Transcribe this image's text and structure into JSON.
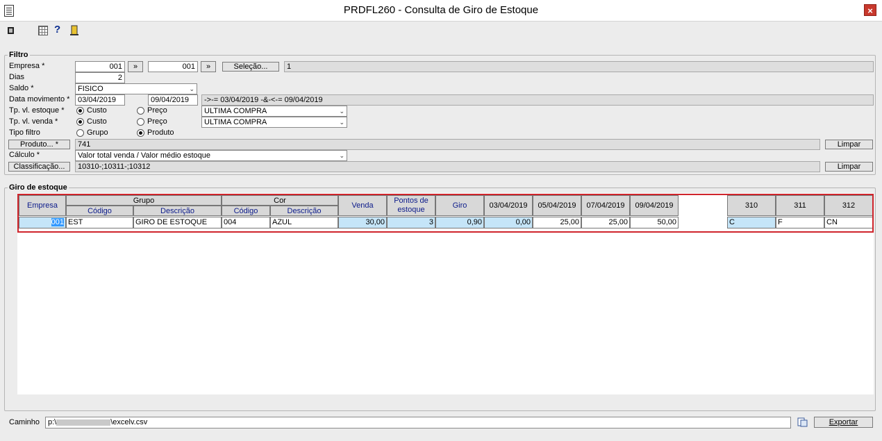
{
  "window": {
    "title": "PRDFL260 - Consulta de Giro de Estoque",
    "close": "×"
  },
  "toolbar": {
    "help": "?"
  },
  "filter": {
    "legend": "Filtro",
    "empresa_label": "Empresa *",
    "empresa_from": "001",
    "empresa_to": "001",
    "range_btn": "»",
    "selecao_btn": "Seleção...",
    "selecao_value": "1",
    "dias_label": "Dias",
    "dias_value": "2",
    "saldo_label": "Saldo *",
    "saldo_value": "FISICO",
    "data_label": "Data movimento *",
    "data_from": "03/04/2019",
    "data_to": "09/04/2019",
    "data_summary": "->-= 03/04/2019 -&-<-= 09/04/2019",
    "tp_estoque_label": "Tp. vl. estoque *",
    "tp_estoque_custo": "Custo",
    "tp_estoque_preco": "Preço",
    "tp_estoque_select": "ULTIMA COMPRA",
    "tp_venda_label": "Tp. vl. venda *",
    "tp_venda_custo": "Custo",
    "tp_venda_preco": "Preço",
    "tp_venda_select": "ULTIMA COMPRA",
    "tipo_filtro_label": "Tipo filtro",
    "tipo_grupo": "Grupo",
    "tipo_produto": "Produto",
    "produto_btn": "Produto... *",
    "produto_value": "741",
    "limpar": "Limpar",
    "calculo_label": "Cálculo *",
    "calculo_value": "Valor total venda / Valor médio estoque",
    "classificacao_btn": "Classificação...",
    "classificacao_value": "10310-;10311-;10312",
    "arrow": "⌄"
  },
  "giro": {
    "legend": "Giro de estoque",
    "headers": {
      "empresa": "Empresa",
      "grupo": "Grupo",
      "grupo_codigo": "Código",
      "grupo_descricao": "Descrição",
      "cor": "Cor",
      "cor_codigo": "Código",
      "cor_descricao": "Descrição",
      "venda": "Venda",
      "pontos": "Pontos de estoque",
      "giro": "Giro",
      "d1": "03/04/2019",
      "d2": "05/04/2019",
      "d3": "07/04/2019",
      "d4": "09/04/2019",
      "c310": "310",
      "c311": "311",
      "c312": "312"
    },
    "row": {
      "empresa": "001",
      "grupo_codigo": "EST",
      "grupo_descricao": "GIRO DE ESTOQUE",
      "cor_codigo": "004",
      "cor_descricao": "AZUL",
      "venda": "30,00",
      "pontos": "3",
      "giro": "0,90",
      "d1": "0,00",
      "d2": "25,00",
      "d3": "25,00",
      "d4": "50,00",
      "c310": "C",
      "c311": "F",
      "c312": "CN"
    }
  },
  "footer": {
    "caminho_label": "Caminho",
    "caminho_prefix": "p:\\",
    "caminho_suffix": "\\excelv.csv",
    "exportar_btn": "Exportar"
  },
  "colors": {
    "highlight": "#d0252c",
    "selected_cell": "#c5e5f8",
    "close": "#c8382c"
  }
}
